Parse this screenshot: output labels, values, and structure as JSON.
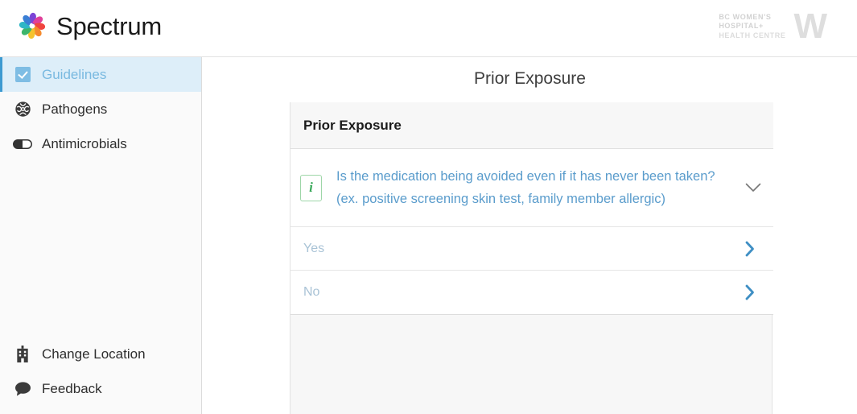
{
  "app": {
    "brand_name": "Spectrum",
    "brand_logo_icon": "spectrum-pinwheel-logo"
  },
  "hospital": {
    "line1": "BC Women's",
    "line2": "Hospital+",
    "line3": "Health Centre",
    "monogram": "W"
  },
  "sidebar": {
    "top_items": [
      {
        "label": "Guidelines",
        "icon": "checkbox-checked-icon",
        "active": true
      },
      {
        "label": "Pathogens",
        "icon": "microbe-icon",
        "active": false
      },
      {
        "label": "Antimicrobials",
        "icon": "pill-capsule-icon",
        "active": false
      }
    ],
    "bottom_items": [
      {
        "label": "Change Location",
        "icon": "hospital-building-icon"
      },
      {
        "label": "Feedback",
        "icon": "speech-bubble-icon"
      }
    ]
  },
  "main": {
    "page_title": "Prior Exposure",
    "card": {
      "header_title": "Prior Exposure",
      "question": {
        "info_glyph": "i",
        "text": "Is the medication being avoided even if it has never been taken? (ex. positive screening skin test, family member allergic)",
        "expand_icon": "chevron-down-icon"
      },
      "answers": [
        {
          "label": "Yes",
          "icon": "chevron-right-icon"
        },
        {
          "label": "No",
          "icon": "chevron-right-icon"
        }
      ]
    }
  },
  "colors": {
    "accent_blue": "#5a9ccc",
    "active_nav_bg": "#ddeef9",
    "active_nav_border": "#3d9ad1",
    "info_green": "#39a85a",
    "chevron_blue": "#3f8fc4",
    "strip_gray": "#f7f7f7"
  }
}
